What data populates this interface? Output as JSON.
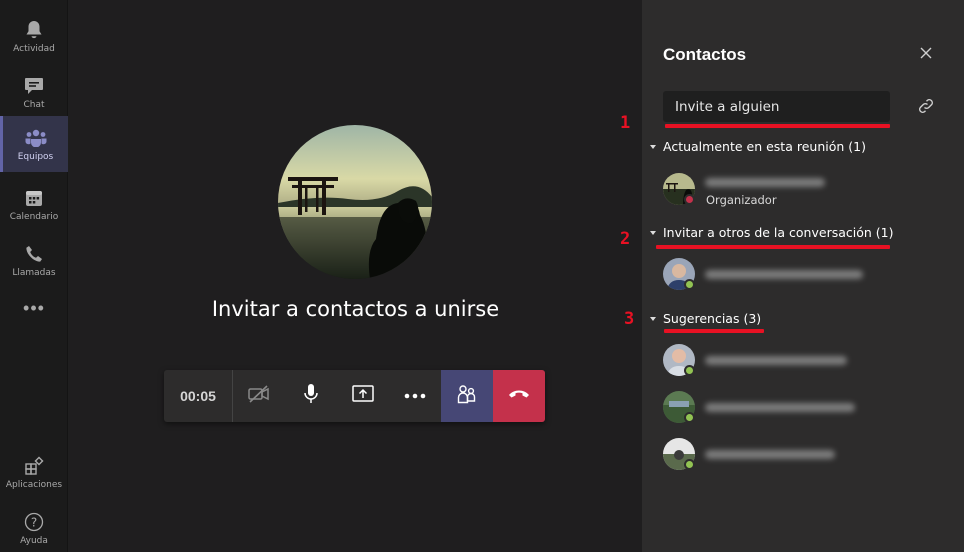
{
  "rail": {
    "items": [
      {
        "label": "Actividad",
        "icon": "bell-icon"
      },
      {
        "label": "Chat",
        "icon": "chat-icon"
      },
      {
        "label": "Equipos",
        "icon": "teams-icon"
      },
      {
        "label": "Calendario",
        "icon": "calendar-icon"
      },
      {
        "label": "Llamadas",
        "icon": "phone-icon"
      }
    ],
    "more": "•••",
    "bottom": [
      {
        "label": "Aplicaciones",
        "icon": "apps-icon"
      },
      {
        "label": "Ayuda",
        "icon": "help-icon"
      }
    ]
  },
  "stage": {
    "title": "Invitar a contactos a unirse",
    "timer": "00:05"
  },
  "panel": {
    "title": "Contactos",
    "invite_placeholder": "Invite a alguien",
    "sections": {
      "current": "Actualmente en esta reunión (1)",
      "invite": "Invitar a otros de la conversación (1)",
      "suggestions": "Sugerencias (3)"
    },
    "organizer_role": "Organizador"
  },
  "annotations": {
    "one": "1",
    "two": "2",
    "three": "3",
    "color": "#e81123"
  },
  "colors": {
    "accent": "#6264a7",
    "hangup": "#c4314b",
    "available": "#92c353",
    "busy": "#c4314b"
  }
}
